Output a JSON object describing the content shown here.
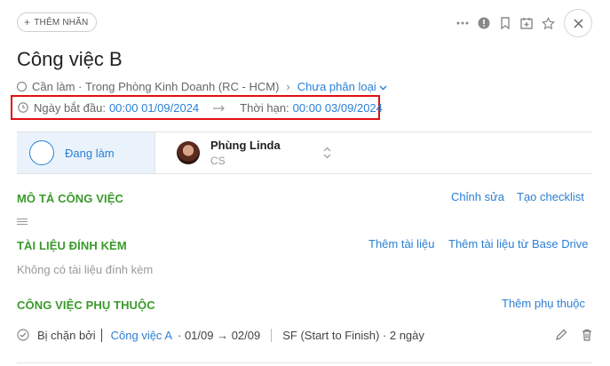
{
  "header": {
    "add_label": "THÊM NHÃN",
    "icons": [
      "more-icon",
      "alert-icon",
      "bookmark-icon",
      "calendar-add-icon",
      "star-icon",
      "close-icon"
    ]
  },
  "task": {
    "title": "Công việc B",
    "state": "Cần làm",
    "location": "Trong Phòng Kinh Doanh (RC - HCM)",
    "category": "Chưa phân loại",
    "start_label": "Ngày bắt đầu:",
    "start_value": "00:00 01/09/2024",
    "deadline_label": "Thời hạn:",
    "deadline_value": "00:00 03/09/2024"
  },
  "status": {
    "label": "Đang làm",
    "assignee_name": "Phùng Linda",
    "assignee_role": "CS"
  },
  "description": {
    "title": "MÔ TẢ CÔNG VIỆC",
    "edit": "Chỉnh sửa",
    "checklist": "Tạo checklist"
  },
  "attachments": {
    "title": "TÀI LIỆU ĐÍNH KÈM",
    "add": "Thêm tài liệu",
    "add_drive": "Thêm tài liệu từ Base Drive",
    "empty": "Không có tài liệu đính kèm"
  },
  "dependencies": {
    "title": "CÔNG VIỆC PHỤ THUỘC",
    "add": "Thêm phụ thuộc",
    "item": {
      "relation": "Bị chặn bởi",
      "task": "Công việc A",
      "dates": "· 01/09 → 02/09",
      "type": "SF (Start to Finish) · 2 ngày"
    }
  },
  "colors": {
    "accent": "#2a7fd4",
    "section": "#3a9a2a",
    "highlight": "#e01010"
  }
}
